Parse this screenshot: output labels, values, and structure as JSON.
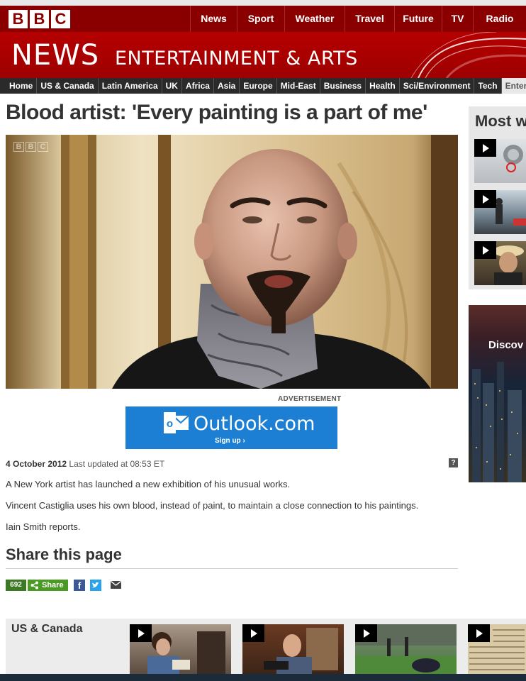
{
  "masthead": {
    "logo_letters": [
      "B",
      "B",
      "C"
    ],
    "nav": [
      "News",
      "Sport",
      "Weather",
      "Travel",
      "Future",
      "TV",
      "Radio"
    ]
  },
  "newsbar": {
    "brand": "NEWS",
    "section": "ENTERTAINMENT & ARTS"
  },
  "section_nav": [
    "Home",
    "US & Canada",
    "Latin America",
    "UK",
    "Africa",
    "Asia",
    "Europe",
    "Mid-East",
    "Business",
    "Health",
    "Sci/Environment",
    "Tech",
    "Enter"
  ],
  "article": {
    "title": "Blood artist: 'Every painting is a part of me'",
    "video_logo": [
      "B",
      "B",
      "C"
    ],
    "date": "4 October 2012",
    "updated": "Last updated at 08:53 ET",
    "help": "?",
    "paragraphs": [
      "A New York artist has launched a new exhibition of his unusual works.",
      "Vincent Castiglia uses his own blood, instead of paint, to maintain a close connection to his paintings.",
      "Iain Smith reports."
    ]
  },
  "ad": {
    "label": "ADVERTISEMENT",
    "brand": "Outlook.com",
    "signup": "Sign up ›",
    "icon_letter": "o"
  },
  "share": {
    "title": "Share this page",
    "count": "692",
    "button": "Share",
    "facebook": "f"
  },
  "sidebar": {
    "most_title": "Most w",
    "promo_text": "Discov"
  },
  "bottom": {
    "title": "US & Canada"
  },
  "colors": {
    "bbc_red": "#8a0000",
    "news_red": "#b50000",
    "nav_dark": "#2a2a2a",
    "share_green": "#4a9a24",
    "outlook_blue": "#1d7fd3"
  }
}
